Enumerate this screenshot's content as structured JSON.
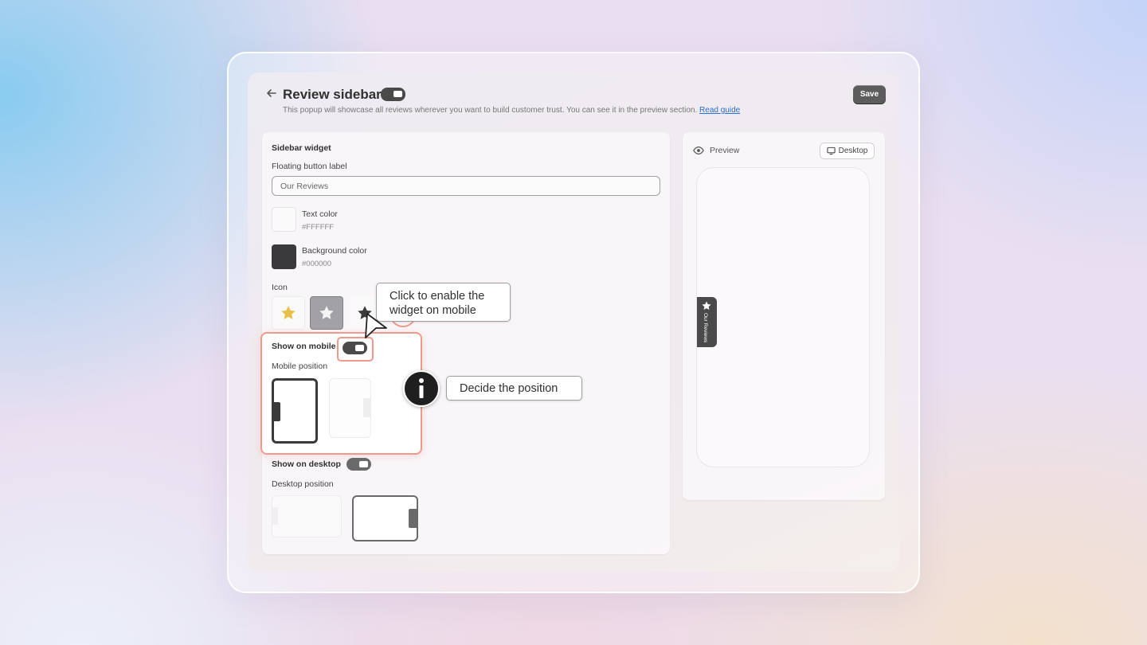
{
  "header": {
    "title": "Review sidebar",
    "subtitle": "This popup will showcase all reviews wherever you want to build customer trust. You can see it in the preview section.",
    "read_guide_link": "Read guide",
    "save_label": "Save"
  },
  "widget": {
    "section_title": "Sidebar widget",
    "floating_label_title": "Floating button label",
    "floating_label_value": "Our Reviews",
    "text_color_label": "Text color",
    "text_color_value": "#FFFFFF",
    "bg_color_label": "Background color",
    "bg_color_value": "#000000",
    "icon_label": "Icon",
    "icons": [
      "star-yellow-icon",
      "star-outline-icon",
      "star-dark-icon"
    ],
    "show_mobile_label": "Show on mobile",
    "mobile_position_label": "Mobile position",
    "show_desktop_label": "Show on desktop",
    "desktop_position_label": "Desktop position"
  },
  "preview": {
    "title": "Preview",
    "device_label": "Desktop",
    "floating_tab_text": "Our Reviews"
  },
  "callouts": {
    "mobile_tip": "Click to enable the widget on mobile",
    "position_tip": "Decide the position",
    "info_icon": "info-icon"
  },
  "colors": {
    "accent_highlight": "#ef9a8c",
    "toggle_on": "#4a4a4a",
    "link": "#2c6ecb"
  }
}
